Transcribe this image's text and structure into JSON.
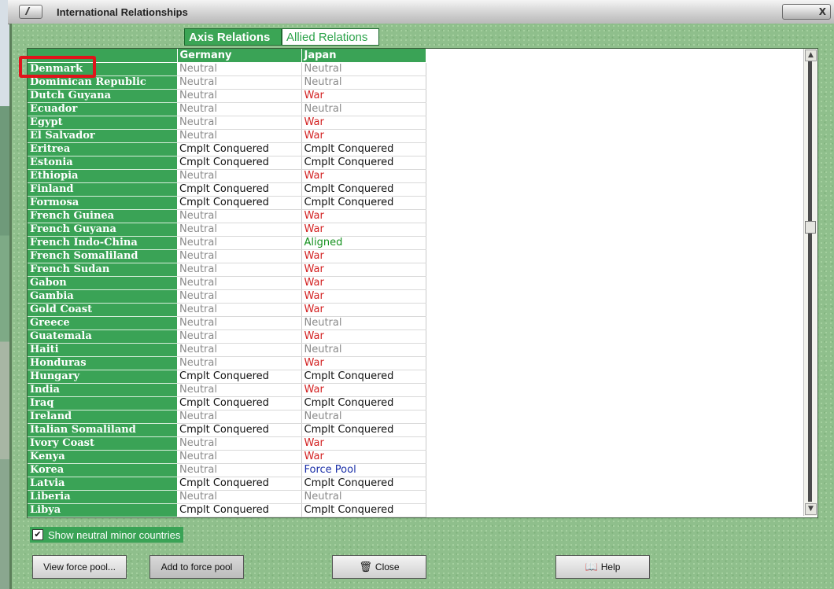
{
  "window": {
    "title": "International Relationships",
    "close_label": "X"
  },
  "tabs": [
    {
      "label": "Axis Relations",
      "active": true
    },
    {
      "label": "Allied Relations",
      "active": false
    }
  ],
  "table": {
    "columns": [
      "Germany",
      "Japan"
    ],
    "rows": [
      {
        "country": "Denmark",
        "germany": "Neutral",
        "japan": "Neutral"
      },
      {
        "country": "Dominican Republic",
        "germany": "Neutral",
        "japan": "Neutral"
      },
      {
        "country": "Dutch Guyana",
        "germany": "Neutral",
        "japan": "War"
      },
      {
        "country": "Ecuador",
        "germany": "Neutral",
        "japan": "Neutral"
      },
      {
        "country": "Egypt",
        "germany": "Neutral",
        "japan": "War"
      },
      {
        "country": "El Salvador",
        "germany": "Neutral",
        "japan": "War"
      },
      {
        "country": "Eritrea",
        "germany": "Cmplt Conquered",
        "japan": "Cmplt Conquered"
      },
      {
        "country": "Estonia",
        "germany": "Cmplt Conquered",
        "japan": "Cmplt Conquered"
      },
      {
        "country": "Ethiopia",
        "germany": "Neutral",
        "japan": "War"
      },
      {
        "country": "Finland",
        "germany": "Cmplt Conquered",
        "japan": "Cmplt Conquered"
      },
      {
        "country": "Formosa",
        "germany": "Cmplt Conquered",
        "japan": "Cmplt Conquered"
      },
      {
        "country": "French Guinea",
        "germany": "Neutral",
        "japan": "War"
      },
      {
        "country": "French Guyana",
        "germany": "Neutral",
        "japan": "War"
      },
      {
        "country": "French Indo-China",
        "germany": "Neutral",
        "japan": "Aligned"
      },
      {
        "country": "French Somaliland",
        "germany": "Neutral",
        "japan": "War"
      },
      {
        "country": "French Sudan",
        "germany": "Neutral",
        "japan": "War"
      },
      {
        "country": "Gabon",
        "germany": "Neutral",
        "japan": "War"
      },
      {
        "country": "Gambia",
        "germany": "Neutral",
        "japan": "War"
      },
      {
        "country": "Gold Coast",
        "germany": "Neutral",
        "japan": "War"
      },
      {
        "country": "Greece",
        "germany": "Neutral",
        "japan": "Neutral"
      },
      {
        "country": "Guatemala",
        "germany": "Neutral",
        "japan": "War"
      },
      {
        "country": "Haiti",
        "germany": "Neutral",
        "japan": "Neutral"
      },
      {
        "country": "Honduras",
        "germany": "Neutral",
        "japan": "War"
      },
      {
        "country": "Hungary",
        "germany": "Cmplt Conquered",
        "japan": "Cmplt Conquered"
      },
      {
        "country": "India",
        "germany": "Neutral",
        "japan": "War"
      },
      {
        "country": "Iraq",
        "germany": "Cmplt Conquered",
        "japan": "Cmplt Conquered"
      },
      {
        "country": "Ireland",
        "germany": "Neutral",
        "japan": "Neutral"
      },
      {
        "country": "Italian Somaliland",
        "germany": "Cmplt Conquered",
        "japan": "Cmplt Conquered"
      },
      {
        "country": "Ivory Coast",
        "germany": "Neutral",
        "japan": "War"
      },
      {
        "country": "Kenya",
        "germany": "Neutral",
        "japan": "War"
      },
      {
        "country": "Korea",
        "germany": "Neutral",
        "japan": "Force Pool"
      },
      {
        "country": "Latvia",
        "germany": "Cmplt Conquered",
        "japan": "Cmplt Conquered"
      },
      {
        "country": "Liberia",
        "germany": "Neutral",
        "japan": "Neutral"
      },
      {
        "country": "Libya",
        "germany": "Cmplt Conquered",
        "japan": "Cmplt Conquered"
      }
    ]
  },
  "status_colors": {
    "Neutral": "#8a8a8a",
    "War": "#d32222",
    "Cmplt Conquered": "#111111",
    "Aligned": "#14911e",
    "Force Pool": "#1a2fa8"
  },
  "options": {
    "show_neutral_label": "Show neutral minor countries",
    "show_neutral_checked": true
  },
  "buttons": {
    "view_force_pool": "View force pool...",
    "add_to_force_pool": "Add to force pool",
    "close": "Close",
    "help": "Help"
  }
}
